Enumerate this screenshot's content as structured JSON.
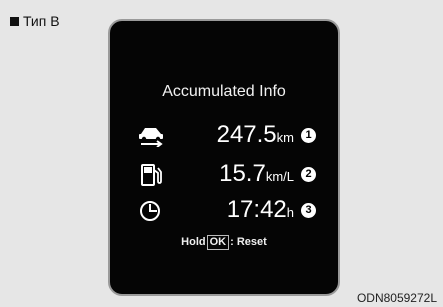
{
  "type_label": "Тип B",
  "screen": {
    "title": "Accumulated Info",
    "rows": [
      {
        "icon": "car-distance-icon",
        "value": "247.5",
        "unit": "km",
        "badge": "1"
      },
      {
        "icon": "fuel-pump-icon",
        "value": "15.7",
        "unit": "km/L",
        "badge": "2"
      },
      {
        "icon": "clock-icon",
        "value": "17:42",
        "unit": "h",
        "badge": "3"
      }
    ],
    "hint": {
      "prefix": "Hold",
      "key": "OK",
      "suffix": ": Reset"
    }
  },
  "figure_code": "ODN8059272L"
}
